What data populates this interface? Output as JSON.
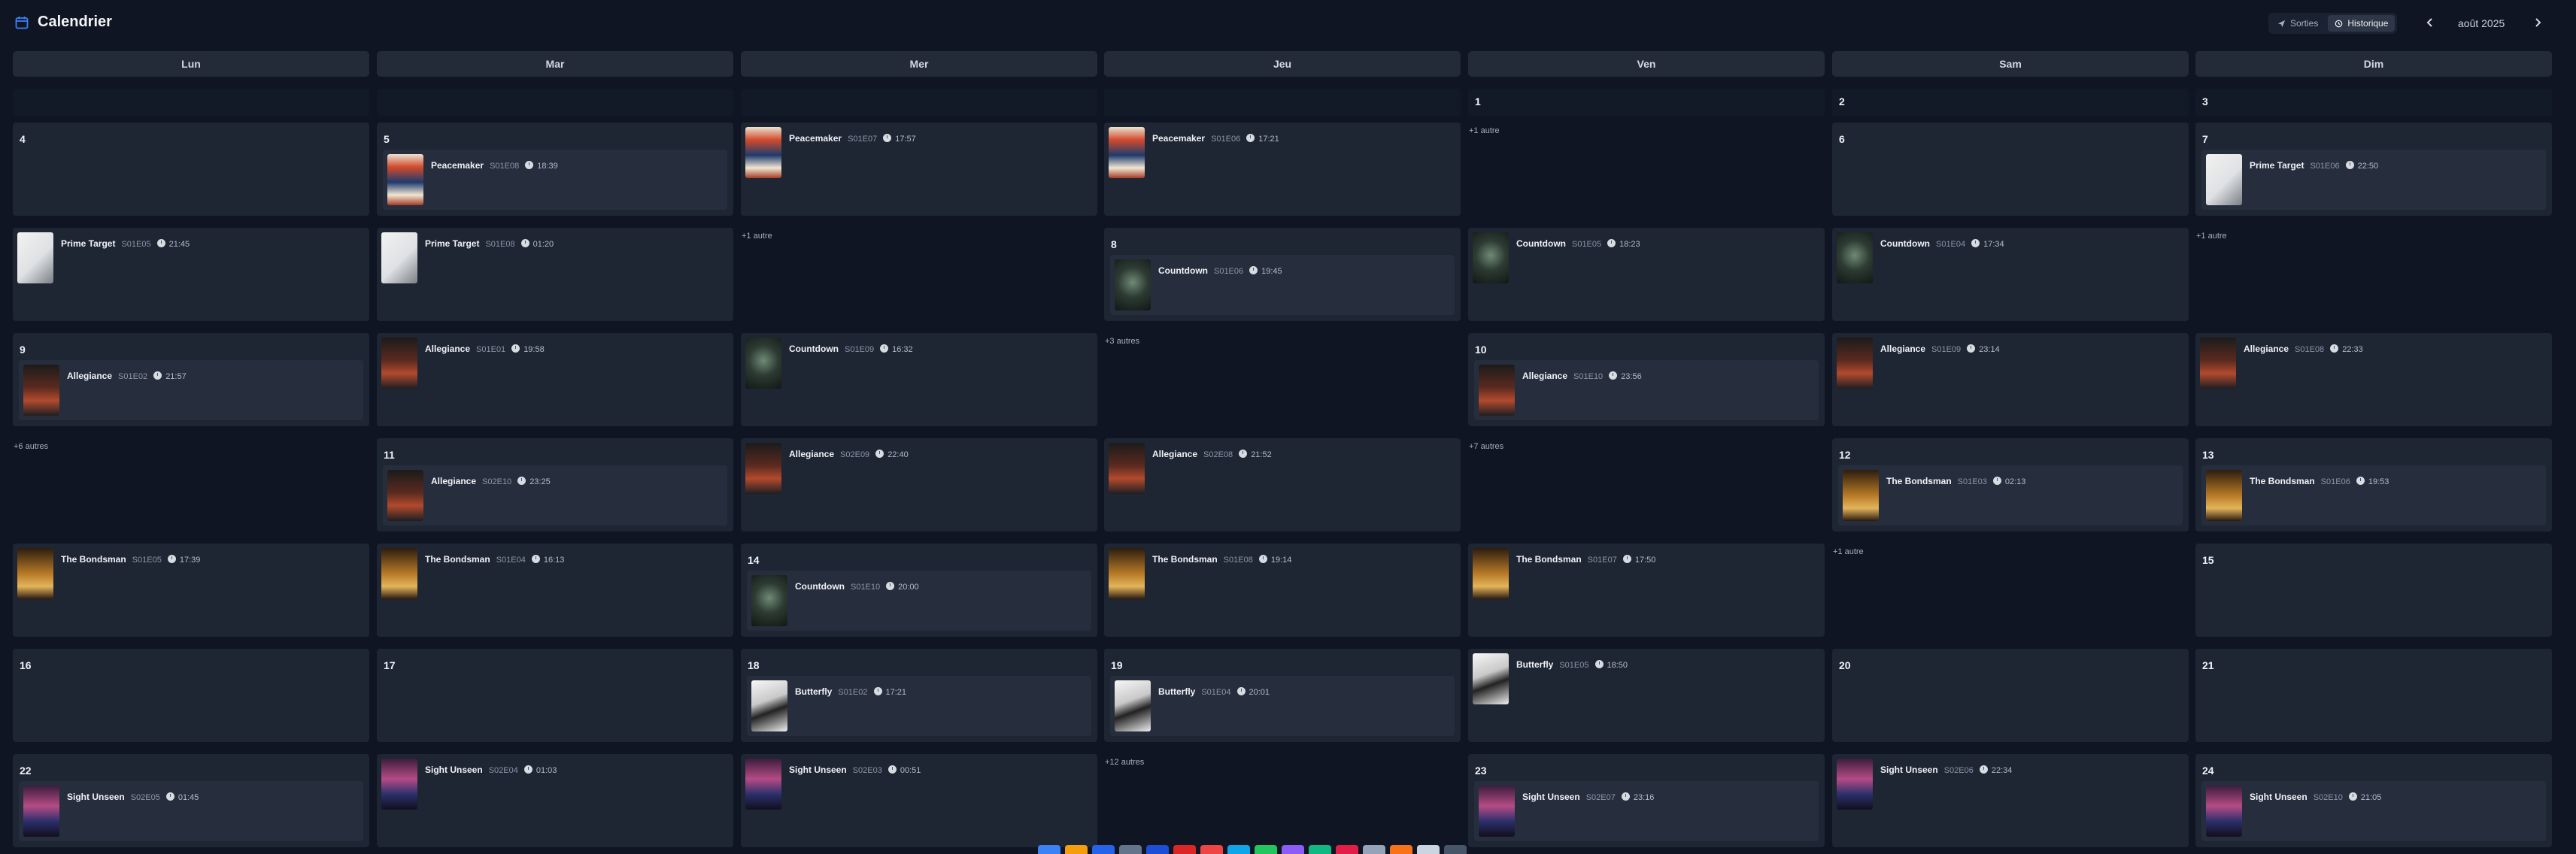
{
  "header": {
    "title": "Calendrier",
    "title_icon": "calendar-icon",
    "toggle": [
      {
        "label": "Sorties",
        "icon": "send-icon",
        "active": false
      },
      {
        "label": "Historique",
        "icon": "history-icon",
        "active": true
      }
    ],
    "prev_icon": "chevron-left-icon",
    "next_icon": "chevron-right-icon",
    "month": "août 2025"
  },
  "weekdays": [
    "Lun",
    "Mar",
    "Mer",
    "Jeu",
    "Ven",
    "Sam",
    "Dim"
  ],
  "weeks": [
    {
      "day_row": [
        "",
        "",
        "",
        "",
        "1",
        "2",
        "3"
      ],
      "event_rows": [
        [
          {
            "day": "4",
            "ep": null
          },
          {
            "day": "5",
            "ep": {
              "show": "Peacemaker",
              "code": "S01E08",
              "time": "18:39",
              "poster": "peacemaker"
            }
          },
          {
            "ep": {
              "show": "Peacemaker",
              "code": "S01E07",
              "time": "17:57",
              "poster": "peacemaker"
            }
          },
          {
            "ep": {
              "show": "Peacemaker",
              "code": "S01E06",
              "time": "17:21",
              "poster": "peacemaker"
            }
          },
          {
            "more": "+1 autre"
          },
          {
            "day": "6",
            "ep": null
          },
          {
            "day": "7",
            "ep": {
              "show": "Prime Target",
              "code": "S01E06",
              "time": "22:50",
              "poster": "primetarget"
            }
          }
        ],
        [
          {
            "ep": {
              "show": "Prime Target",
              "code": "S01E05",
              "time": "21:45",
              "poster": "primetarget"
            }
          },
          {
            "ep": {
              "show": "Prime Target",
              "code": "S01E08",
              "time": "01:20",
              "poster": "primetarget"
            }
          },
          {
            "more": "+1 autre"
          },
          {
            "day": "8",
            "ep": {
              "show": "Countdown",
              "code": "S01E06",
              "time": "19:45",
              "poster": "countdown"
            }
          },
          {
            "ep": {
              "show": "Countdown",
              "code": "S01E05",
              "time": "18:23",
              "poster": "countdown"
            }
          },
          {
            "ep": {
              "show": "Countdown",
              "code": "S01E04",
              "time": "17:34",
              "poster": "countdown"
            }
          },
          {
            "more": "+1 autre"
          }
        ]
      ]
    },
    {
      "event_rows": [
        [
          {
            "day": "9",
            "ep": {
              "show": "Allegiance",
              "code": "S01E02",
              "time": "21:57",
              "poster": "allegiance"
            }
          },
          {
            "ep": {
              "show": "Allegiance",
              "code": "S01E01",
              "time": "19:58",
              "poster": "allegiance"
            }
          },
          {
            "ep": {
              "show": "Countdown",
              "code": "S01E09",
              "time": "16:32",
              "poster": "countdown"
            }
          },
          {
            "more": "+3 autres"
          },
          {
            "day": "10",
            "ep": {
              "show": "Allegiance",
              "code": "S01E10",
              "time": "23:56",
              "poster": "allegiance"
            }
          },
          {
            "ep": {
              "show": "Allegiance",
              "code": "S01E09",
              "time": "23:14",
              "poster": "allegiance"
            }
          },
          {
            "ep": {
              "show": "Allegiance",
              "code": "S01E08",
              "time": "22:33",
              "poster": "allegiance"
            }
          }
        ],
        [
          {
            "more": "+6 autres"
          },
          {
            "day": "11",
            "ep": {
              "show": "Allegiance",
              "code": "S02E10",
              "time": "23:25",
              "poster": "allegiance"
            }
          },
          {
            "ep": {
              "show": "Allegiance",
              "code": "S02E09",
              "time": "22:40",
              "poster": "allegiance"
            }
          },
          {
            "ep": {
              "show": "Allegiance",
              "code": "S02E08",
              "time": "21:52",
              "poster": "allegiance"
            }
          },
          {
            "more": "+7 autres"
          },
          {
            "day": "12",
            "ep": {
              "show": "The Bondsman",
              "code": "S01E03",
              "time": "02:13",
              "poster": "bondsman"
            }
          },
          {
            "day": "13",
            "ep": {
              "show": "The Bondsman",
              "code": "S01E06",
              "time": "19:53",
              "poster": "bondsman"
            }
          }
        ],
        [
          {
            "ep": {
              "show": "The Bondsman",
              "code": "S01E05",
              "time": "17:39",
              "poster": "bondsman"
            }
          },
          {
            "ep": {
              "show": "The Bondsman",
              "code": "S01E04",
              "time": "16:13",
              "poster": "bondsman"
            }
          },
          {
            "day": "14",
            "ep": {
              "show": "Countdown",
              "code": "S01E10",
              "time": "20:00",
              "poster": "countdown"
            }
          },
          {
            "ep": {
              "show": "The Bondsman",
              "code": "S01E08",
              "time": "19:14",
              "poster": "bondsman"
            }
          },
          {
            "ep": {
              "show": "The Bondsman",
              "code": "S01E07",
              "time": "17:50",
              "poster": "bondsman"
            }
          },
          {
            "more": "+1 autre"
          },
          {
            "day": "15",
            "ep": null
          }
        ]
      ]
    },
    {
      "event_rows": [
        [
          {
            "day": "16",
            "ep": null
          },
          {
            "day": "17",
            "ep": null
          },
          {
            "day": "18",
            "ep": {
              "show": "Butterfly",
              "code": "S01E02",
              "time": "17:21",
              "poster": "butterfly"
            }
          },
          {
            "day": "19",
            "ep": {
              "show": "Butterfly",
              "code": "S01E04",
              "time": "20:01",
              "poster": "butterfly"
            }
          },
          {
            "ep": {
              "show": "Butterfly",
              "code": "S01E05",
              "time": "18:50",
              "poster": "butterfly"
            }
          },
          {
            "day": "20",
            "ep": null
          },
          {
            "day": "21",
            "ep": null
          }
        ],
        [
          {
            "day": "22",
            "ep": {
              "show": "Sight Unseen",
              "code": "S02E05",
              "time": "01:45",
              "poster": "sightunseen"
            }
          },
          {
            "ep": {
              "show": "Sight Unseen",
              "code": "S02E04",
              "time": "01:03",
              "poster": "sightunseen"
            }
          },
          {
            "ep": {
              "show": "Sight Unseen",
              "code": "S02E03",
              "time": "00:51",
              "poster": "sightunseen"
            }
          },
          {
            "more": "+12 autres"
          },
          {
            "day": "23",
            "ep": {
              "show": "Sight Unseen",
              "code": "S02E07",
              "time": "23:16",
              "poster": "sightunseen"
            }
          },
          {
            "ep": {
              "show": "Sight Unseen",
              "code": "S02E06",
              "time": "22:34",
              "poster": "sightunseen"
            }
          },
          {
            "day": "24",
            "ep": {
              "show": "Sight Unseen",
              "code": "S02E10",
              "time": "21:05",
              "poster": "sightunseen"
            }
          }
        ]
      ]
    }
  ],
  "colors": {
    "background": "#0f1522",
    "cell": "#1e2533",
    "cell_inset": "#262e3d",
    "header_cell": "#232a38",
    "accent": "#3b82f6"
  }
}
